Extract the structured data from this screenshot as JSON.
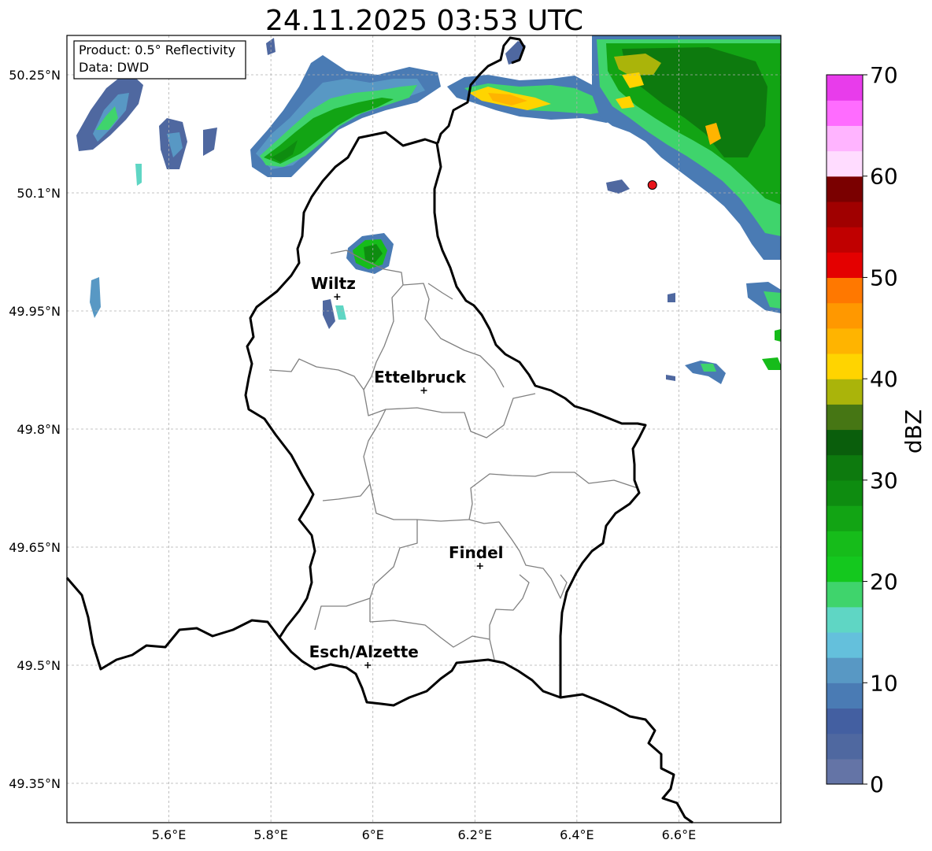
{
  "title": "24.11.2025 03:53 UTC",
  "info_box": {
    "product": "Product: 0.5° Reflectivity",
    "data": "Data: DWD"
  },
  "map_extent": {
    "lon": [
      5.4,
      6.8
    ],
    "lat": [
      49.3,
      50.3
    ]
  },
  "lon_ticks": [
    {
      "value": 5.6,
      "label": "5.6°E"
    },
    {
      "value": 5.8,
      "label": "5.8°E"
    },
    {
      "value": 6.0,
      "label": "6°E"
    },
    {
      "value": 6.2,
      "label": "6.2°E"
    },
    {
      "value": 6.4,
      "label": "6.4°E"
    },
    {
      "value": 6.6,
      "label": "6.6°E"
    }
  ],
  "lat_ticks": [
    {
      "value": 50.25,
      "label": "50.25°N"
    },
    {
      "value": 50.1,
      "label": "50.1°N"
    },
    {
      "value": 49.95,
      "label": "49.95°N"
    },
    {
      "value": 49.8,
      "label": "49.8°N"
    },
    {
      "value": 49.65,
      "label": "49.65°N"
    },
    {
      "value": 49.5,
      "label": "49.5°N"
    },
    {
      "value": 49.35,
      "label": "49.35°N"
    }
  ],
  "cities": [
    {
      "name": "Wiltz",
      "lon": 5.93,
      "lat": 49.968
    },
    {
      "name": "Ettelbruck",
      "lon": 6.1,
      "lat": 49.849
    },
    {
      "name": "Findel",
      "lon": 6.21,
      "lat": 49.626
    },
    {
      "name": "Esch/Alzette",
      "lon": 5.99,
      "lat": 49.5
    }
  ],
  "radar_site": {
    "lon": 6.548,
    "lat": 50.11,
    "color": "#e8141b"
  },
  "colorbar": {
    "label": "dBZ",
    "min": 0,
    "max": 70,
    "tick_values": [
      0,
      10,
      20,
      30,
      40,
      50,
      60,
      70
    ],
    "tick_labels": [
      "0",
      "10",
      "20",
      "30",
      "40",
      "50",
      "60",
      "70"
    ],
    "colors": [
      "#6474a6",
      "#4f68a0",
      "#435fa1",
      "#4a7bb4",
      "#5898c4",
      "#64c0dc",
      "#5fd6c4",
      "#3fd46c",
      "#14c81e",
      "#16bc1a",
      "#12a414",
      "#0e8c10",
      "#0d7a0e",
      "#0a5e0c",
      "#467614",
      "#aab40a",
      "#ffd400",
      "#ffb400",
      "#ff9800",
      "#ff7800",
      "#e40000",
      "#c00000",
      "#a00000",
      "#7a0000",
      "#ffdcff",
      "#ffb4ff",
      "#ff6cff",
      "#e83ceb"
    ]
  },
  "colors": {
    "country_border": "#000000",
    "district_border": "#808080",
    "grid": "#b0b0b0"
  }
}
